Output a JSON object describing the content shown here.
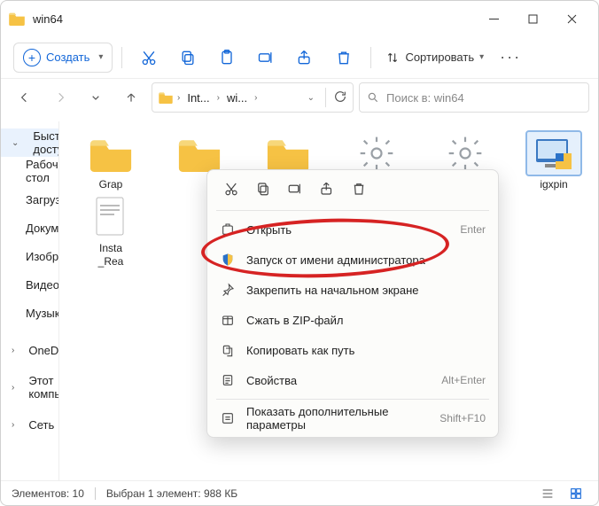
{
  "window": {
    "title": "win64"
  },
  "toolbar": {
    "new_label": "Создать",
    "sort_label": "Сортировать"
  },
  "breadcrumb": {
    "c1": "Int...",
    "c2": "wi..."
  },
  "search": {
    "placeholder": "Поиск в: win64"
  },
  "sidebar": {
    "quick": "Быстрый доступ",
    "desktop": "Рабочий стол",
    "downloads": "Загрузки",
    "documents": "Документы",
    "pictures": "Изображения",
    "video": "Видео",
    "music": "Музыка",
    "onedrive": "OneDrive",
    "thispc": "Этот компьютер",
    "network": "Сеть"
  },
  "files": {
    "f1": "Grap",
    "f5": "Insta\n_Rea",
    "f8": "igxpin"
  },
  "ctx": {
    "open": "Открыть",
    "open_sc": "Enter",
    "runadmin": "Запуск от имени администратора",
    "pinstart": "Закрепить на начальном экране",
    "zip": "Сжать в ZIP-файл",
    "copypath": "Копировать как путь",
    "props": "Свойства",
    "props_sc": "Alt+Enter",
    "more": "Показать дополнительные параметры",
    "more_sc": "Shift+F10"
  },
  "status": {
    "count": "Элементов: 10",
    "sel": "Выбран 1 элемент: 988 КБ"
  }
}
